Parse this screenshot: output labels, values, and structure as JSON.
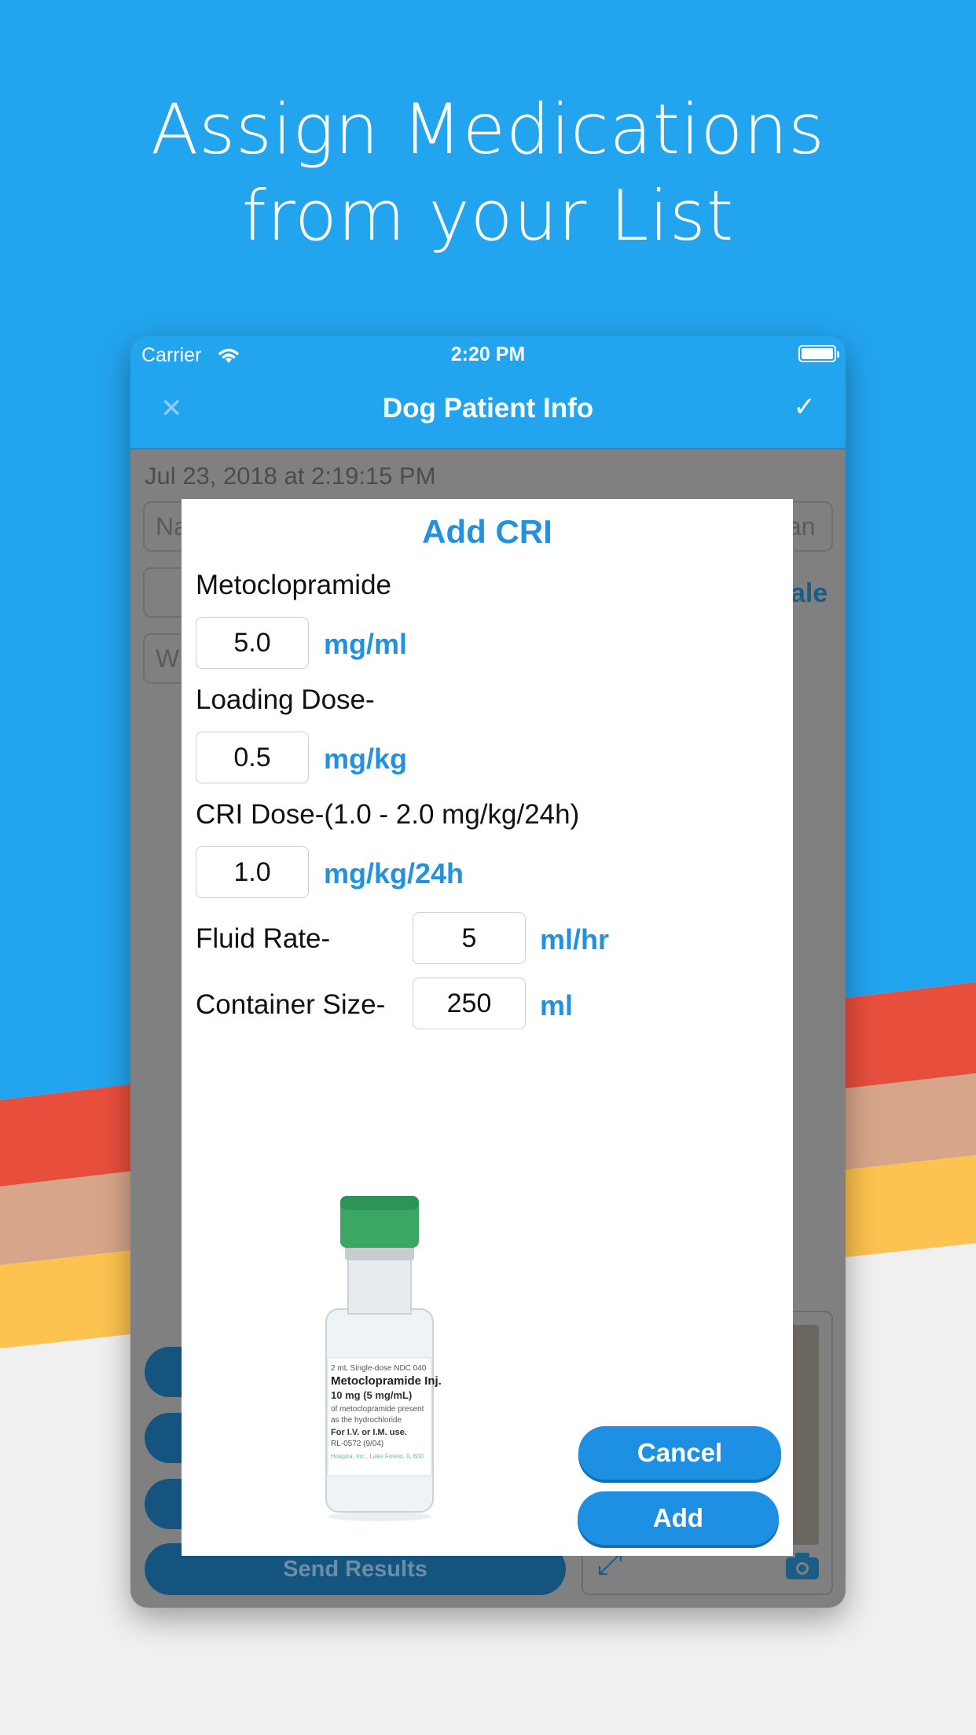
{
  "headline": {
    "line1": "Assign Medications",
    "line2": "from your List"
  },
  "colors": {
    "sky": "#23a4ee",
    "accent": "#2391e0",
    "stripe_red": "#e84e3c",
    "stripe_tan": "#d7a68a",
    "stripe_yellow": "#fdc24f"
  },
  "status": {
    "carrier": "Carrier",
    "time": "2:20 PM"
  },
  "nav": {
    "title": "Dog Patient Info",
    "close_icon": "close-icon",
    "done_icon": "checkmark-icon"
  },
  "background": {
    "date": "Jul 23, 2018 at 2:19:15 PM",
    "name_field_partial": "Na",
    "right_field_partial": "an",
    "right_blue_partial": "ale",
    "weight_field_partial": "W",
    "send_button": "Send Results"
  },
  "modal": {
    "title": "Add CRI",
    "drug_name": "Metoclopramide",
    "concentration": {
      "value": "5.0",
      "unit": "mg/ml"
    },
    "loading_label": "Loading Dose-",
    "loading": {
      "value": "0.5",
      "unit": "mg/kg"
    },
    "cri_label": "CRI Dose-",
    "cri_range": "(1.0 - 2.0 mg/kg/24h)",
    "cri": {
      "value": "1.0",
      "unit": "mg/kg/24h"
    },
    "fluid_label": "Fluid Rate-",
    "fluid": {
      "value": "5",
      "unit": "ml/hr"
    },
    "container_label": "Container Size-",
    "container": {
      "value": "250",
      "unit": "ml"
    },
    "cancel_label": "Cancel",
    "add_label": "Add"
  },
  "vial_label": {
    "line1": "2 mL Single-dose   NDC 040",
    "line2": "Metoclopramide Inj.",
    "line3": "10 mg (5 mg/mL)",
    "line4": "of metoclopramide present",
    "line5": "as the hydrochloride",
    "line6": "For I.V. or I.M. use.",
    "line7": "RL-0572 (9/04)",
    "line8": "Hospira, Inc., Lake Forest, IL 600"
  }
}
